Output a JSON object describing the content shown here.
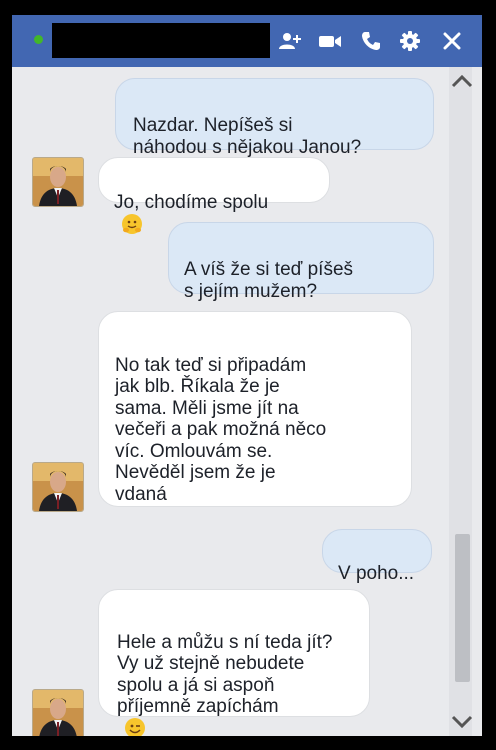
{
  "header": {
    "contact_name": "",
    "icons": [
      "add-friend-icon",
      "video-call-icon",
      "phone-icon",
      "gear-icon",
      "close-icon"
    ],
    "status_color": "#42b72a",
    "bar_color": "#4267b2"
  },
  "messages": [
    {
      "direction": "outgoing",
      "text": "Nazdar. Nepíšeš si\nnáhodou s nějakou Janou?"
    },
    {
      "direction": "incoming",
      "text": "Jo, chodíme spolu",
      "emoji": "hugging-face"
    },
    {
      "direction": "outgoing",
      "text": "A víš že si teď píšeš\ns jejím mužem?"
    },
    {
      "direction": "incoming",
      "text": "No tak teď si připadám\njak blb. Říkala že je\nsama. Měli jsme jít na\nvečeři a pak možná něco\nvíc. Omlouvám se.\nNevěděl jsem že je\nvdaná"
    },
    {
      "direction": "outgoing",
      "text": "V poho..."
    },
    {
      "direction": "incoming",
      "text": "Hele a můžu s ní teda jít?\nVy už stejně nebudete\nspolu a já si aspoň\npříjemně zapíchám",
      "emoji": "winking-face"
    }
  ],
  "colors": {
    "outgoing_bubble": "#dbe8f6",
    "incoming_bubble": "#ffffff",
    "background": "#e9eaed"
  }
}
